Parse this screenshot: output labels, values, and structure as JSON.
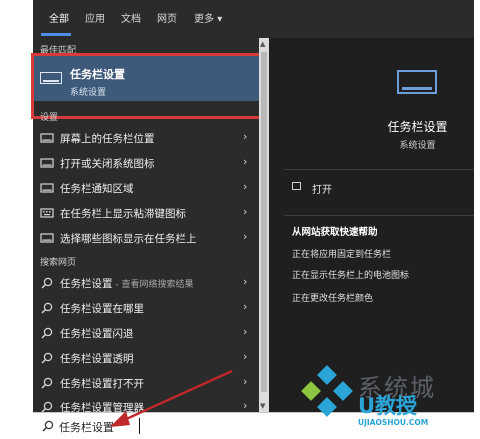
{
  "tabs": [
    "全部",
    "应用",
    "文档",
    "网页",
    "更多"
  ],
  "more_arrow": "▾",
  "best_match": {
    "section": "最佳匹配",
    "title": "任务栏设置",
    "subtitle": "系统设置"
  },
  "settings": {
    "section": "设置",
    "items": [
      {
        "label": "屏幕上的任务栏位置",
        "icon": "taskbar-icon"
      },
      {
        "label": "打开或关闭系统图标",
        "icon": "taskbar-icon"
      },
      {
        "label": "任务栏通知区域",
        "icon": "taskbar-icon"
      },
      {
        "label": "在任务栏上显示粘滞键图标",
        "icon": "keyboard-icon"
      },
      {
        "label": "选择哪些图标显示在任务栏上",
        "icon": "taskbar-icon"
      }
    ]
  },
  "web": {
    "section": "搜索网页",
    "items": [
      {
        "label": "任务栏设置",
        "hint": " - 查看网络搜索结果"
      },
      {
        "label": "任务栏设置在哪里",
        "hint": ""
      },
      {
        "label": "任务栏设置闪退",
        "hint": ""
      },
      {
        "label": "任务栏设置透明",
        "hint": ""
      },
      {
        "label": "任务栏设置打不开",
        "hint": ""
      },
      {
        "label": "任务栏设置管理器",
        "hint": ""
      }
    ]
  },
  "preview": {
    "title": "任务栏设置",
    "subtitle": "系统设置",
    "open": "打开",
    "web_help_title": "从网站获取快速帮助",
    "web_links": [
      "正在将应用固定到任务栏",
      "正在显示任务栏上的电池图标",
      "正在更改任务栏颜色"
    ]
  },
  "search": {
    "value": "任务栏设置"
  },
  "chevron": "›",
  "watermark": {
    "line1": "系统城",
    "line2": "U教授",
    "line3": "UJIAOSHOU.COM"
  },
  "colors": {
    "accent": "#4c8ee8",
    "highlight_frame": "#d63a3a",
    "selected_row": "#3d5a7a"
  }
}
